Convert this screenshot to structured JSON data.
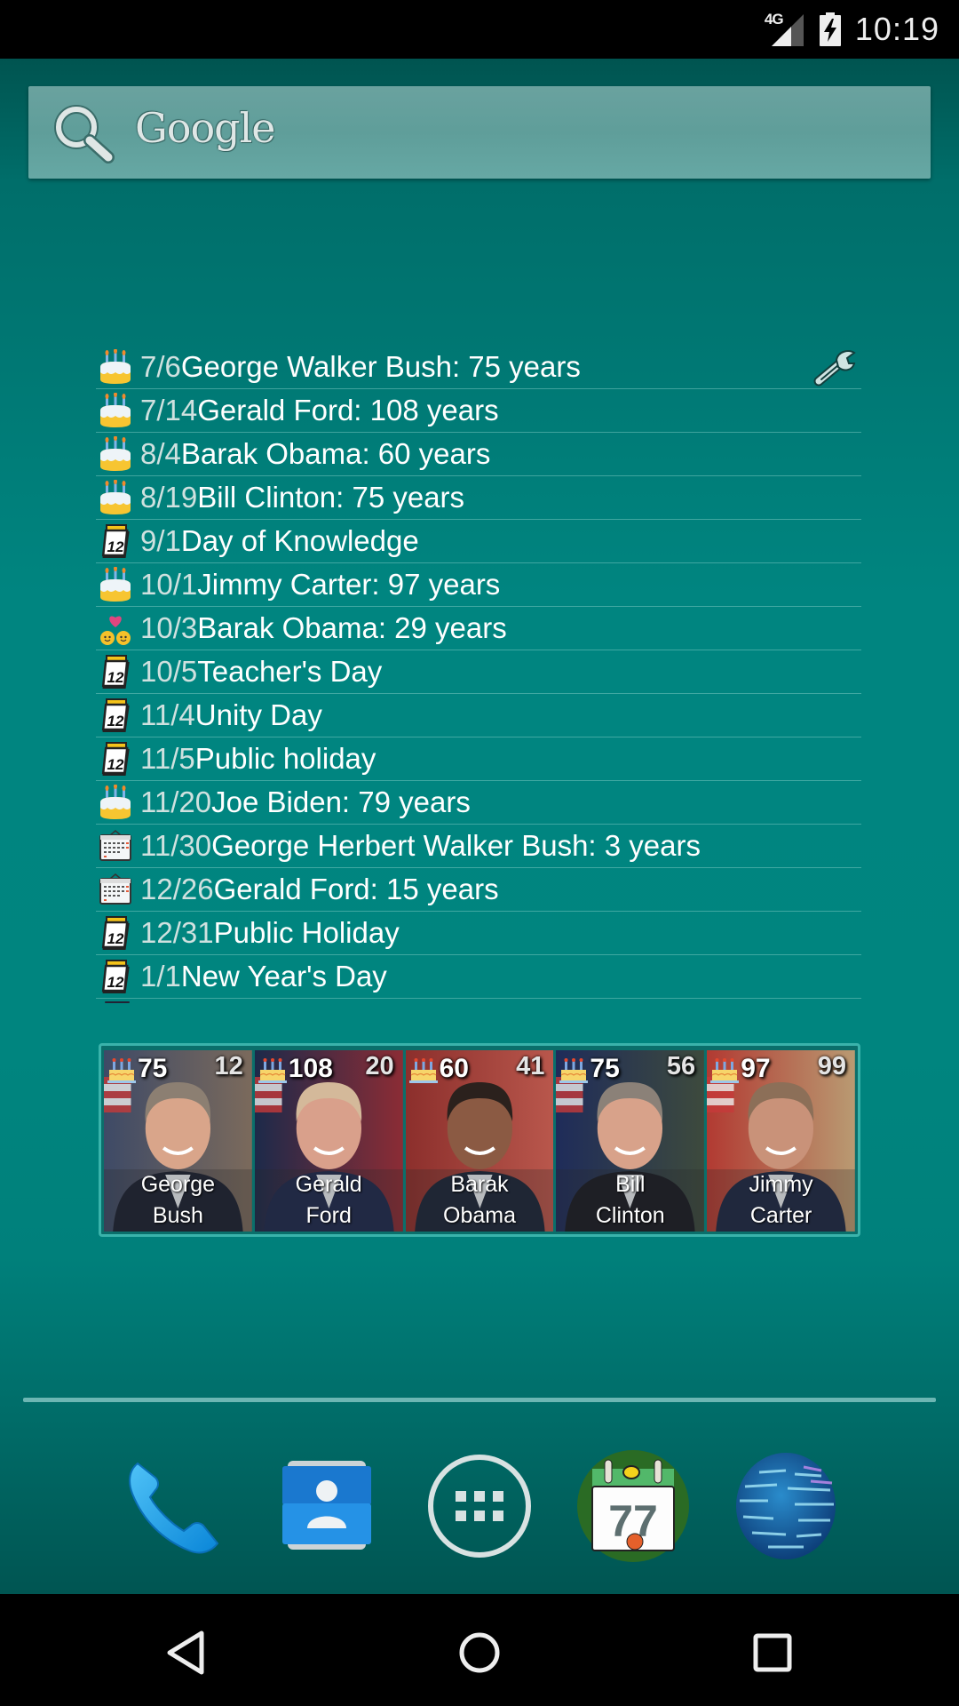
{
  "status_bar": {
    "network_label": "4G",
    "battery_state": "charging",
    "time": "10:19"
  },
  "search": {
    "label": "Google",
    "icon": "search-icon"
  },
  "events_widget": {
    "settings_icon": "wrench-icon",
    "events": [
      {
        "icon": "birthday-cake",
        "date": "7/6",
        "text": "George Walker Bush: 75 years"
      },
      {
        "icon": "birthday-cake",
        "date": "7/14",
        "text": "Gerald Ford: 108 years"
      },
      {
        "icon": "birthday-cake",
        "date": "8/4",
        "text": "Barak Obama: 60 years"
      },
      {
        "icon": "birthday-cake",
        "date": "8/19",
        "text": "Bill Clinton: 75 years"
      },
      {
        "icon": "tear-off-calendar",
        "date": "9/1",
        "text": "Day of Knowledge"
      },
      {
        "icon": "birthday-cake",
        "date": "10/1",
        "text": "Jimmy Carter: 97 years"
      },
      {
        "icon": "couple-heart",
        "date": "10/3",
        "text": "Barak Obama: 29 years"
      },
      {
        "icon": "tear-off-calendar",
        "date": "10/5",
        "text": "Teacher's Day"
      },
      {
        "icon": "tear-off-calendar",
        "date": "11/4",
        "text": "Unity Day"
      },
      {
        "icon": "tear-off-calendar",
        "date": "11/5",
        "text": "Public holiday"
      },
      {
        "icon": "birthday-cake",
        "date": "11/20",
        "text": "Joe Biden: 79 years"
      },
      {
        "icon": "wall-calendar",
        "date": "11/30",
        "text": "George Herbert Walker Bush: 3 years"
      },
      {
        "icon": "wall-calendar",
        "date": "12/26",
        "text": "Gerald Ford: 15 years"
      },
      {
        "icon": "tear-off-calendar",
        "date": "12/31",
        "text": "Public Holiday"
      },
      {
        "icon": "tear-off-calendar",
        "date": "1/1",
        "text": "New Year's Day"
      }
    ]
  },
  "photo_widget": {
    "tiles": [
      {
        "age": "75",
        "days_left": "12",
        "first_name": "George",
        "last_name": "Bush"
      },
      {
        "age": "108",
        "days_left": "20",
        "first_name": "Gerald",
        "last_name": "Ford"
      },
      {
        "age": "60",
        "days_left": "41",
        "first_name": "Barak",
        "last_name": "Obama"
      },
      {
        "age": "75",
        "days_left": "56",
        "first_name": "Bill",
        "last_name": "Clinton"
      },
      {
        "age": "97",
        "days_left": "99",
        "first_name": "Jimmy",
        "last_name": "Carter"
      }
    ]
  },
  "dock": {
    "apps": [
      {
        "name": "Phone",
        "icon": "phone-icon"
      },
      {
        "name": "Contacts",
        "icon": "contacts-icon"
      },
      {
        "name": "All apps",
        "icon": "app-drawer-icon"
      },
      {
        "name": "Calendar",
        "icon": "calendar-app-icon",
        "badge_text": "77"
      },
      {
        "name": "Browser",
        "icon": "globe-icon"
      }
    ]
  },
  "nav_bar": {
    "buttons": [
      "back",
      "home",
      "recents"
    ]
  },
  "colors": {
    "wallpaper": "#00857f",
    "search_bar": "#64a19e",
    "divider": "#7fc3bf",
    "photo_border": "#3ab3ab"
  }
}
